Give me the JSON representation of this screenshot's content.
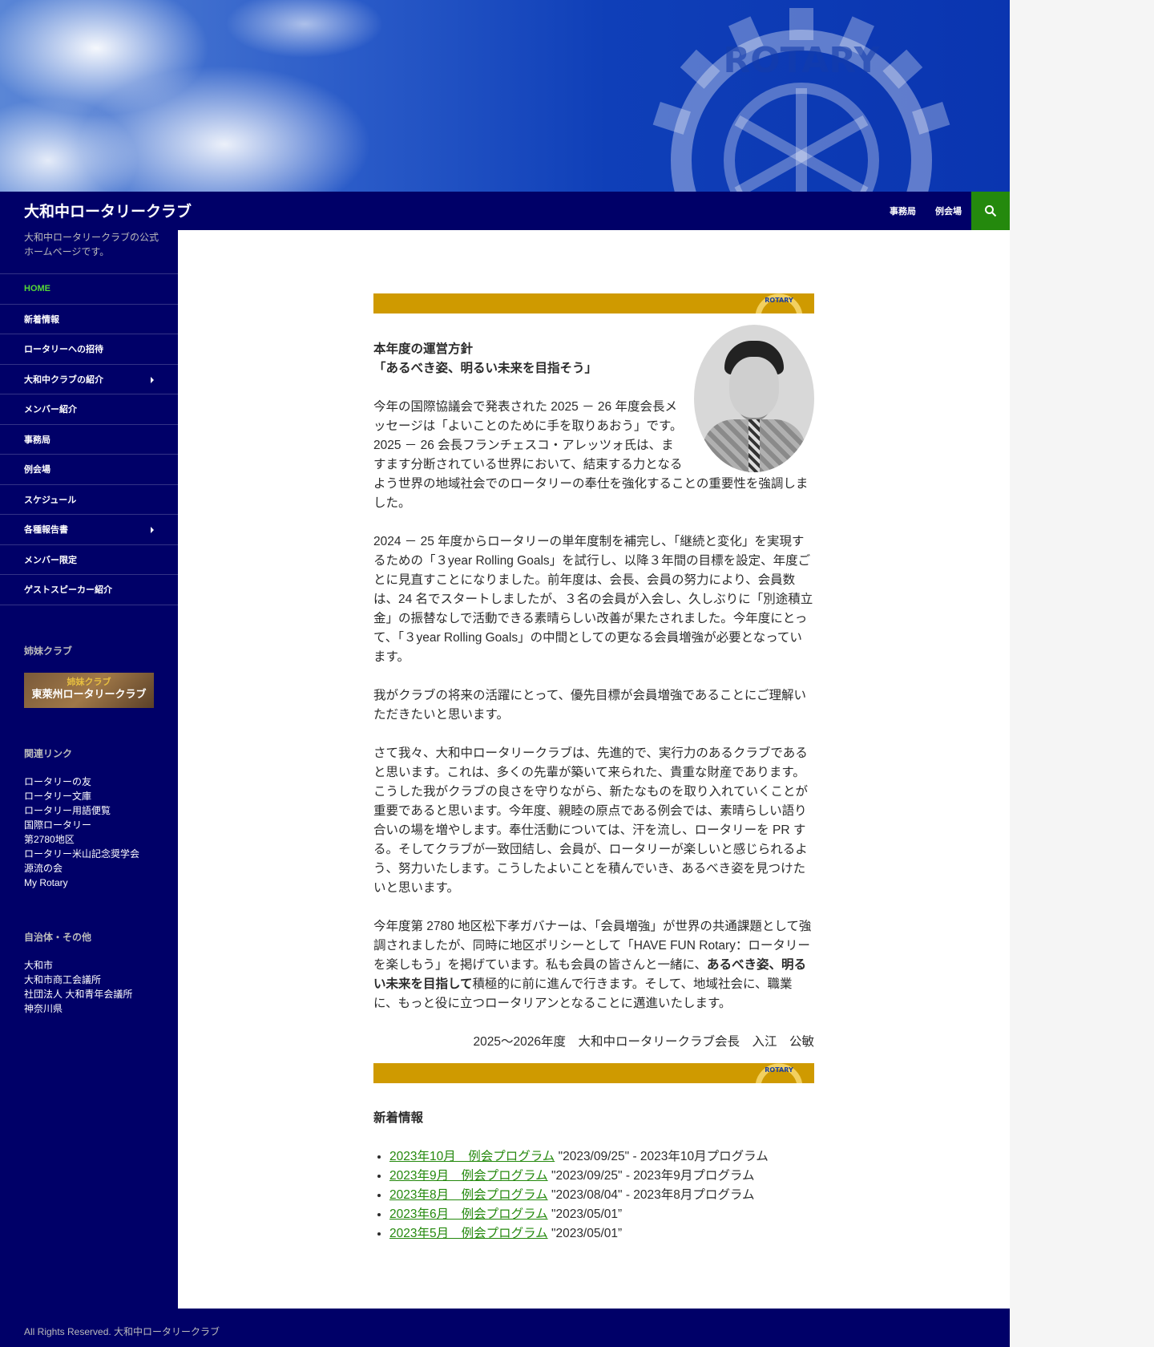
{
  "site": {
    "title": "大和中ロータリークラブ",
    "description": "大和中ロータリークラブの公式ホームページです。",
    "hero_logo_text": "ROTARY"
  },
  "topnav": [
    "事務局",
    "例会場"
  ],
  "nav": [
    {
      "label": "HOME"
    },
    {
      "label": "新着情報"
    },
    {
      "label": "ロータリーへの招待"
    },
    {
      "label": "大和中クラブの紹介"
    },
    {
      "label": "メンバー紹介"
    },
    {
      "label": "事務局"
    },
    {
      "label": "例会場"
    },
    {
      "label": "スケジュール"
    },
    {
      "label": "各種報告書"
    },
    {
      "label": "メンバー限定"
    },
    {
      "label": "ゲストスピーカー紹介"
    }
  ],
  "sister": {
    "title": "姉妹クラブ",
    "banner_top": "姉妹クラブ",
    "banner_main": "東萊州ロータリークラブ"
  },
  "related": {
    "title": "関連リンク",
    "items": [
      "ロータリーの友",
      "ロータリー文庫",
      "ロータリー用語便覧",
      "国際ロータリー",
      "第2780地区",
      "ロータリー米山記念奨学会",
      "源流の会",
      "My Rotary"
    ]
  },
  "gov": {
    "title": "自治体・その他",
    "items": [
      "大和市",
      "大和市商工会議所",
      "社団法人 大和青年会議所",
      "神奈川県"
    ]
  },
  "main": {
    "heading1": "本年度の運営方針",
    "heading2": "「あるべき姿、明るい未来を目指そう」",
    "p1": "今年の国際協議会で発表された 2025 － 26 年度会長メッセージは「よいことのために手を取りあおう」です。2025 － 26 会長フランチェスコ・アレッツォ氏は、ますます分断されている世界において、結束する力となるよう世界の地域社会でのロータリーの奉仕を強化することの重要性を強調しました。",
    "p2": "2024 － 25 年度からロータリーの単年度制を補完し、「継続と変化」を実現するための「３year Rolling Goals」を試行し、以降３年間の目標を設定、年度ごとに見直すことになりました。前年度は、会長、会員の努力により、会員数は、24 名でスタートしましたが、３名の会員が入会し、久しぶりに「別途積立金」の振替なしで活動できる素晴らしい改善が果たされました。今年度にとって、「３year Rolling Goals」の中間としての更なる会員増強が必要となっています。",
    "p3": "我がクラブの将来の活躍にとって、優先目標が会員増強であることにご理解いただきたいと思います。",
    "p4": "さて我々、大和中ロータリークラブは、先進的で、実行力のあるクラブであると思います。これは、多くの先輩が築いて来られた、貴重な財産であります。こうした我がクラブの良さを守りながら、新たなものを取り入れていくことが重要であると思います。今年度、親睦の原点である例会では、素晴らしい語り合いの場を増やします。奉仕活動については、汗を流し、ロータリーを PR する。そしてクラブが一致団結し、会員が、ロータリーが楽しいと感じられるよう、努力いたします。こうしたよいことを積んでいき、あるべき姿を見つけたいと思います。",
    "p5_a": "今年度第 2780 地区松下孝ガバナーは、「会員増強」が世界の共通課題として強調されましたが、同時に地区ポリシーとして「HAVE FUN Rotary：ロータリーを楽しもう」を掲げています。私も会員の皆さんと一緒に、",
    "p5_bold": "あるべき姿、明るい未来を目指して",
    "p5_b": "積極的に前に進んで行きます。そして、地域社会に、職業に、もっと役に立つロータリアンとなることに邁進いたします。",
    "signature": "2025〜2026年度　大和中ロータリークラブ会長　入江　公敏",
    "news_title": "新着情報",
    "news": [
      {
        "link": "2023年10月　例会プログラム",
        "rest": "\"2023/09/25\" - 2023年10月プログラム"
      },
      {
        "link": "2023年9月　例会プログラム",
        "rest": "\"2023/09/25\" - 2023年9月プログラム"
      },
      {
        "link": "2023年8月　例会プログラム",
        "rest": "\"2023/08/04\" - 2023年8月プログラム"
      },
      {
        "link": "2023年6月　例会プログラム",
        "rest": "\"2023/05/01”"
      },
      {
        "link": "2023年5月　例会プログラム",
        "rest": "\"2023/05/01”"
      }
    ]
  },
  "footer": "All Rights Reserved. 大和中ロータリークラブ",
  "colors": {
    "navy": "#000068",
    "green": "#24890d",
    "gold": "#cf9a00"
  }
}
